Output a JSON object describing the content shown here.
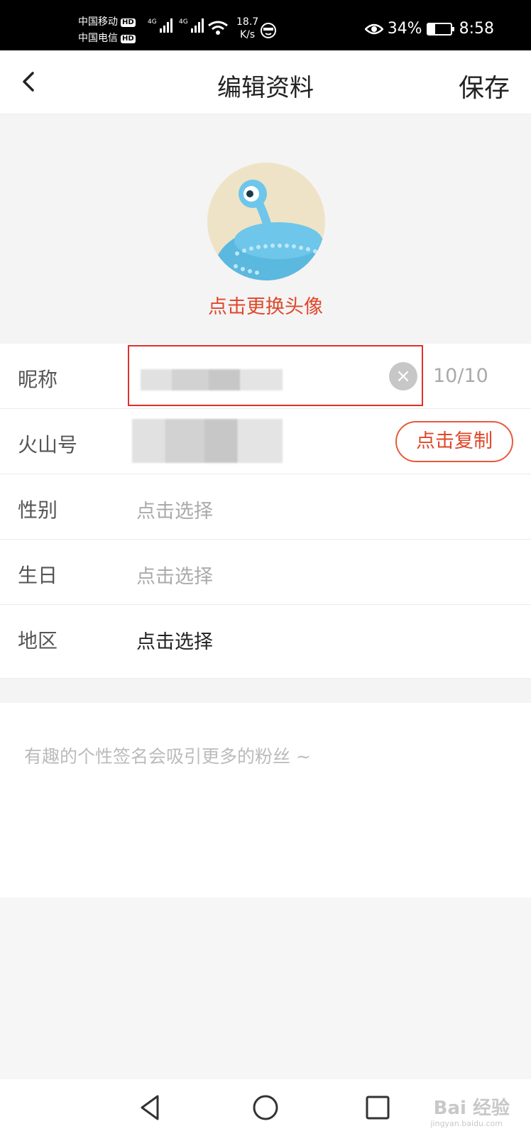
{
  "status_bar": {
    "carrier1": "中国移动",
    "carrier2": "中国电信",
    "hd": "HD",
    "net1": "4G",
    "net2": "4G",
    "speed_value": "18.7",
    "speed_unit": "K/s",
    "battery_percent": "34%",
    "battery_level": 0.34,
    "time": "8:58"
  },
  "header": {
    "title": "编辑资料",
    "save_label": "保存"
  },
  "avatar": {
    "change_label": "点击更换头像"
  },
  "form": {
    "nickname": {
      "label": "昵称",
      "count": "10/10",
      "clear_icon": "×"
    },
    "huoshan_id": {
      "label": "火山号",
      "copy_label": "点击复制"
    },
    "gender": {
      "label": "性别",
      "value": "点击选择"
    },
    "birthday": {
      "label": "生日",
      "value": "点击选择"
    },
    "region": {
      "label": "地区",
      "value": "点击选择"
    }
  },
  "signature": {
    "placeholder": "有趣的个性签名会吸引更多的粉丝 ~"
  },
  "watermark": {
    "text": "Bai 经验",
    "sub": "jingyan.baidu.com"
  },
  "colors": {
    "accent": "#e0472a",
    "highlight": "#e0302a"
  }
}
